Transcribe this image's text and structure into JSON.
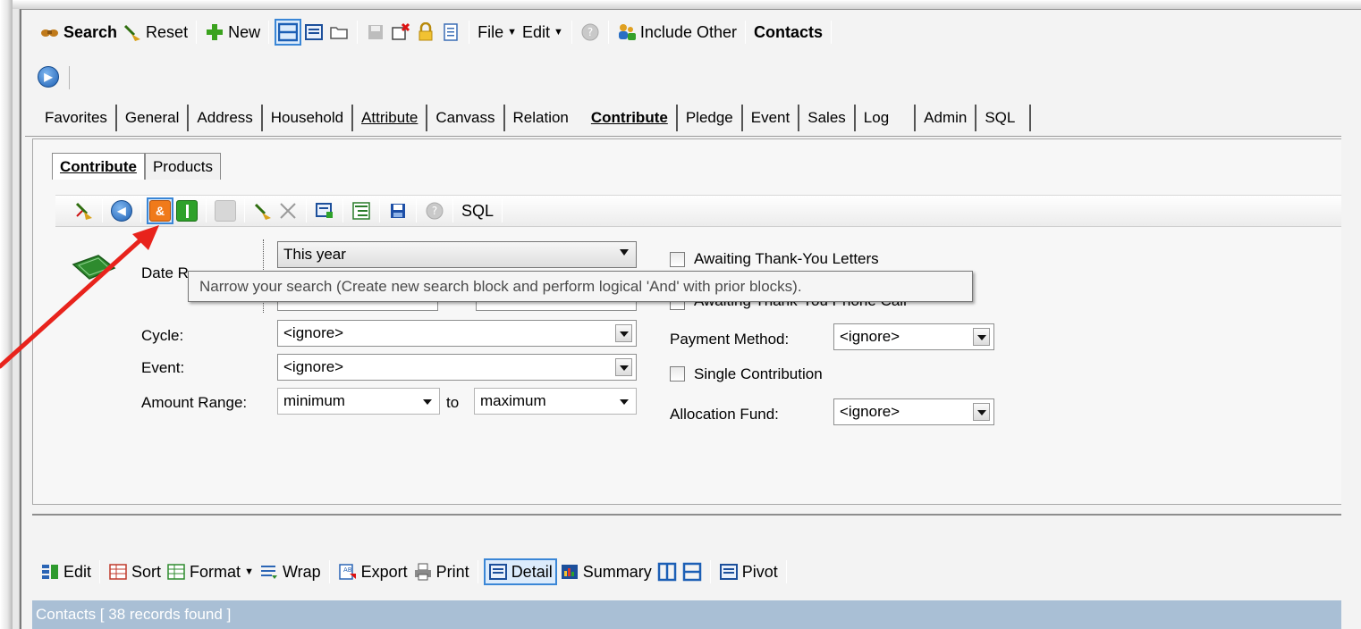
{
  "top_toolbar": {
    "search": "Search",
    "reset": "Reset",
    "new": "New",
    "file": "File",
    "edit": "Edit",
    "include_other": "Include Other",
    "contacts": "Contacts"
  },
  "main_tabs": [
    "Favorites",
    "General",
    "Address",
    "Household",
    "Attribute",
    "Canvass",
    "Relation",
    "Contribute",
    "Pledge",
    "Event",
    "Sales",
    "Log",
    "Admin",
    "SQL"
  ],
  "sub_tabs": [
    "Contribute",
    "Products"
  ],
  "sub_toolbar": {
    "sql": "SQL"
  },
  "form": {
    "date_label": "Date R",
    "date_range_value": "This year",
    "cycle_label": "Cycle:",
    "cycle_value": "<ignore>",
    "event_label": "Event:",
    "event_value": "<ignore>",
    "amount_label": "Amount Range:",
    "amount_min": "minimum",
    "amount_to": "to",
    "amount_max": "maximum",
    "awaiting_letters": "Awaiting Thank-You Letters",
    "awaiting_phone": "Awaiting Thank-You Phone Call",
    "payment_label": "Payment Method:",
    "payment_value": "<ignore>",
    "single_contribution": "Single Contribution",
    "allocation_label": "Allocation Fund:",
    "allocation_value": "<ignore>"
  },
  "tooltip": "Narrow your search (Create new search block and perform logical 'And' with prior blocks).",
  "results_toolbar": {
    "edit": "Edit",
    "sort": "Sort",
    "format": "Format",
    "wrap": "Wrap",
    "export": "Export",
    "print": "Print",
    "detail": "Detail",
    "summary": "Summary",
    "pivot": "Pivot"
  },
  "status": "Contacts [ 38 records found ]",
  "colors": {
    "status_bar": "#a9bfd5",
    "arrow": "#e8231c",
    "selected_outline": "#3a86d6"
  }
}
